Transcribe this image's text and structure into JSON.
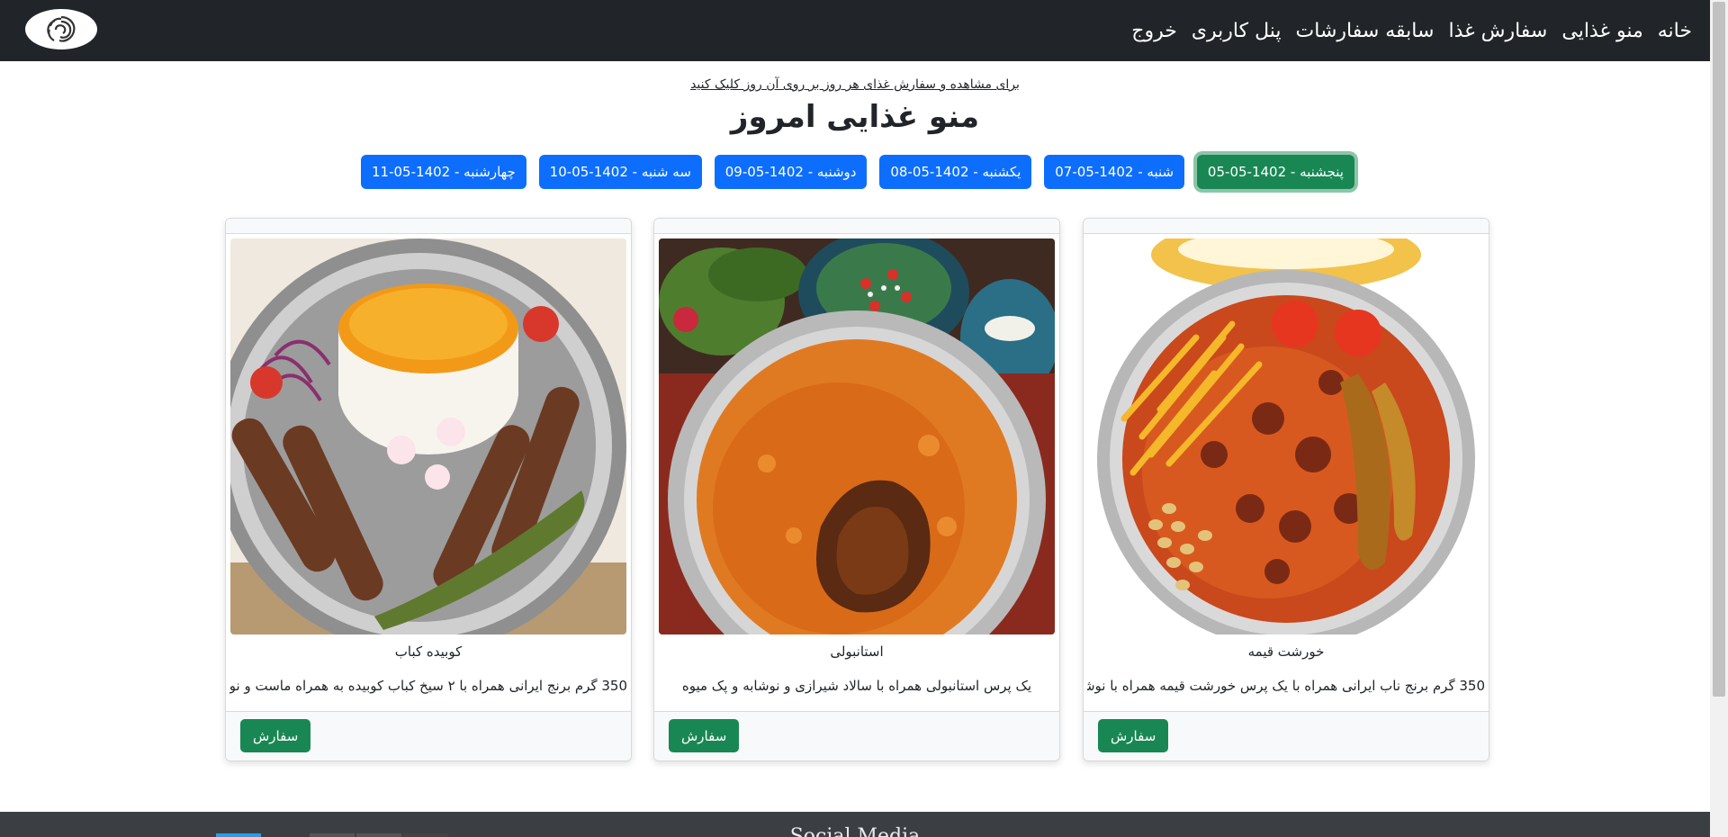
{
  "navbar": {
    "links": [
      "خانه",
      "منو غذایی",
      "سفارش غذا",
      "سابقه سفارشات",
      "پنل کاربری",
      "خروج"
    ]
  },
  "hint": "برای مشاهده و سفارش غذای هر روز بر روی آن روز کلیک کنید",
  "page_title": "منو غذایی امروز",
  "days": [
    {
      "label": "پنجشنبه - 1402-05-05",
      "active": true
    },
    {
      "label": "شنبه - 1402-05-07",
      "active": false
    },
    {
      "label": "یکشنبه - 1402-05-08",
      "active": false
    },
    {
      "label": "دوشنبه - 1402-05-09",
      "active": false
    },
    {
      "label": "سه شنبه - 1402-05-10",
      "active": false
    },
    {
      "label": "چهارشنبه - 1402-05-11",
      "active": false
    }
  ],
  "foods": [
    {
      "title": "خورشت قیمه",
      "description": "350 گرم برنج ناب ایرانی همراه با یک پرس خورشت قیمه همراه با نوشابه",
      "order_label": "سفارش",
      "image": "gheymeh stew photo"
    },
    {
      "title": "استانبولی",
      "description": "یک پرس استانبولی همراه با سالاد شیرازی و نوشابه و پک میوه",
      "order_label": "سفارش",
      "image": "estamboli polo photo"
    },
    {
      "title": "کوبیده کباب",
      "description": "350 گرم برنج ایرانی همراه با ۲ سیخ کباب کوبیده به همراه ماست و نوشابه",
      "order_label": "سفارش",
      "image": "koobideh kebab photo"
    }
  ],
  "footer": {
    "title": "Social Media"
  },
  "colors": {
    "navbar": "#212529",
    "primary": "#0d6efd",
    "success": "#198754"
  }
}
